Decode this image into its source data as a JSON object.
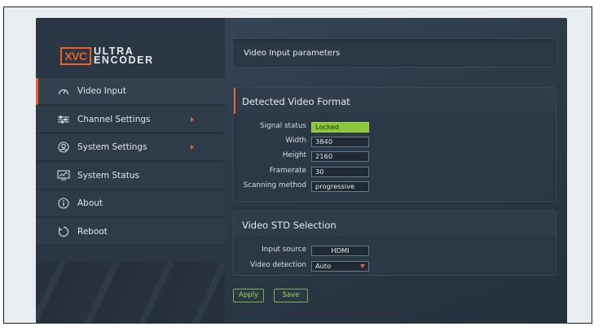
{
  "logo": {
    "badge": "XVC",
    "line1": "ULTRA",
    "line2": "ENCODER"
  },
  "sidebar": {
    "items": [
      {
        "label": "Video Input",
        "icon": "gauge-icon",
        "active": true,
        "has_submenu": false
      },
      {
        "label": "Channel Settings",
        "icon": "sliders-icon",
        "active": false,
        "has_submenu": true
      },
      {
        "label": "System Settings",
        "icon": "user-circle-icon",
        "active": false,
        "has_submenu": true
      },
      {
        "label": "System Status",
        "icon": "monitor-chart-icon",
        "active": false,
        "has_submenu": false
      },
      {
        "label": "About",
        "icon": "info-icon",
        "active": false,
        "has_submenu": false
      },
      {
        "label": "Reboot",
        "icon": "reboot-icon",
        "active": false,
        "has_submenu": false
      }
    ]
  },
  "header": {
    "title": "Video Input parameters"
  },
  "detected": {
    "title": "Detected Video Format",
    "fields": [
      {
        "label": "Signal status",
        "value": "Locked"
      },
      {
        "label": "Width",
        "value": "3840"
      },
      {
        "label": "Height",
        "value": "2160"
      },
      {
        "label": "Framerate",
        "value": "30"
      },
      {
        "label": "Scanning method",
        "value": "progressive"
      }
    ]
  },
  "std": {
    "title": "Video STD Selection",
    "input_source": {
      "label": "Input source",
      "value": "HDMI"
    },
    "video_detection": {
      "label": "Video detection",
      "value": "Auto"
    }
  },
  "actions": {
    "apply": "Apply",
    "save": "Save"
  },
  "colors": {
    "accent": "#e8632a",
    "locked": "#8ac73a",
    "button": "#9bd45b"
  }
}
